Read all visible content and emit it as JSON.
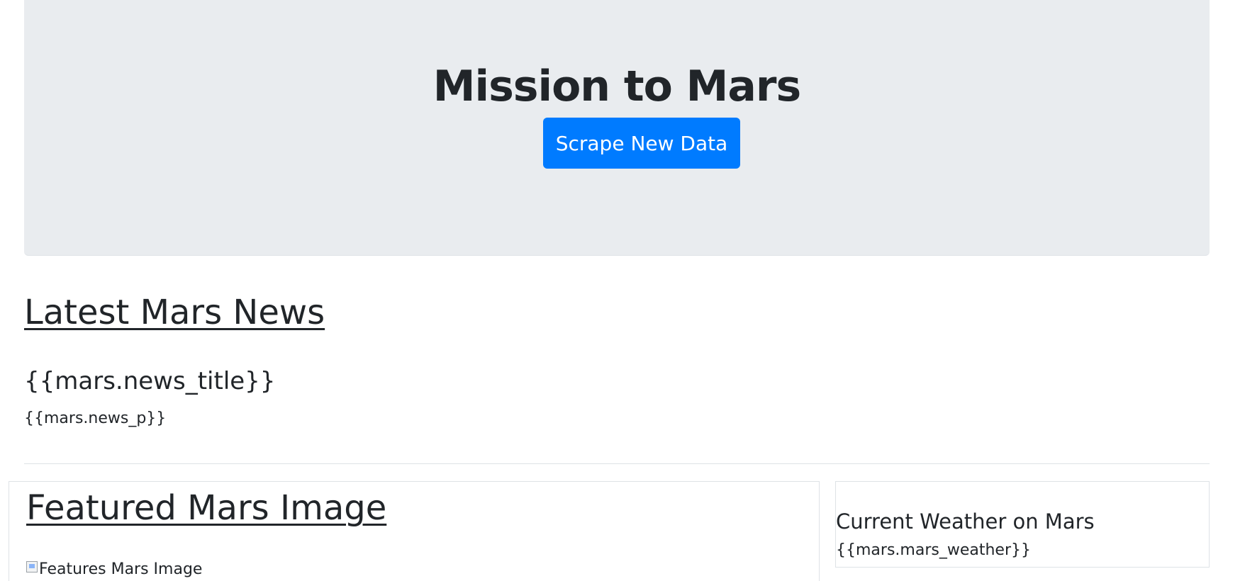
{
  "jumbotron": {
    "title": "Mission to Mars",
    "button_label": "Scrape New Data",
    "button_color": "#007bff",
    "background_color": "#e9ecef"
  },
  "news": {
    "heading": "Latest Mars News",
    "title": "{{mars.news_title}}",
    "paragraph": "{{mars.news_p}}"
  },
  "featured_image": {
    "heading": "Featured Mars Image",
    "alt_text": "Features Mars Image",
    "icon": "broken-image-icon"
  },
  "weather": {
    "heading": "Current Weather on Mars",
    "text": "{{mars.mars_weather}}"
  }
}
